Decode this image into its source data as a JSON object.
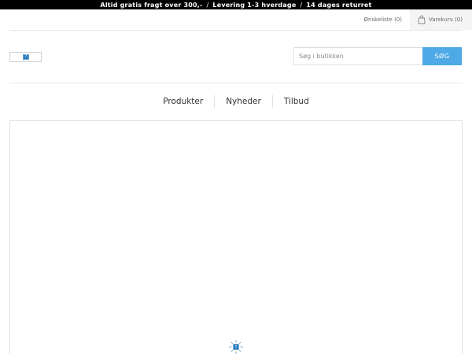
{
  "topbar": {
    "items": [
      "Altid gratis fragt over 300,-",
      "Levering 1-3 hverdage",
      "14 dages returret"
    ],
    "separator": "/"
  },
  "header": {
    "wishlist_label": "Ønskeliste (0)",
    "cart_label": "Varekurv (0)"
  },
  "search": {
    "placeholder": "Søg i butikken",
    "button_label": "SØG"
  },
  "nav": {
    "items": [
      "Produkter",
      "Nyheder",
      "Tilbud"
    ]
  },
  "colors": {
    "topbar_bg": "#000000",
    "accent": "#4ea9e6"
  },
  "icons": {
    "cart": "shopping-bag-icon",
    "loader": "loading-spinner-icon",
    "flag": "language-flag-icon"
  }
}
